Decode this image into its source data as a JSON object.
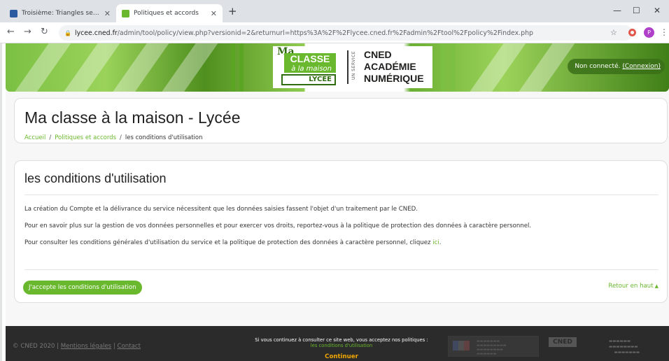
{
  "browser": {
    "tabs": [
      {
        "title": "Troisième: Triangles semblables",
        "active": false
      },
      {
        "title": "Politiques et accords",
        "active": true
      }
    ],
    "new_tab_icon": "plus-icon",
    "url_host": "lycee.cned.fr",
    "url_path": "/admin/tool/policy/view.php?versionid=2&returnurl=https%3A%2F%2Flycee.cned.fr%2Fadmin%2Ftool%2Fpolicy%2Findex.php",
    "avatar_letter": "P"
  },
  "banner": {
    "logo": {
      "ma": "Ma",
      "classe": "CLASSE",
      "a_la_maison": "à la maison",
      "lycee": "LYCÉE"
    },
    "service_label": "UN SERVICE",
    "cned_lines": [
      "CNED",
      "ACADÉMIE",
      "NUMÉRIQUE"
    ],
    "login_status": "Non connecté.",
    "login_link": "(Connexion)"
  },
  "header": {
    "site_title": "Ma classe à la maison - Lycée",
    "breadcrumb": {
      "home": "Accueil",
      "separator": "/",
      "policies": "Politiques et accords",
      "current": "les conditions d'utilisation"
    }
  },
  "policy": {
    "title": "les conditions d'utilisation",
    "paragraphs": [
      "La création du Compte et la délivrance du service nécessitent que les données saisies fassent l'objet d'un traitement par le CNED.",
      "Pour en savoir plus sur la gestion de vos données personnelles et pour exercer vos droits, reportez-vous à la politique de protection des données à caractère personnel.",
      "Pour consulter les conditions générales d'utilisation du service et la politique de protection des données à caractère personnel, cliquez "
    ],
    "link_here": "ici",
    "period": ".",
    "accept_button": "J'accepte les conditions d'utilisation",
    "back_to_top": "Retour en haut"
  },
  "footer": {
    "copyright": "© CNED 2020",
    "legal": "Mentions légales",
    "contact": "Contact",
    "divider": "|",
    "consent_text": "Si vous continuez à consulter ce site web, vous acceptez nos politiques :",
    "consent_link": "les conditions d'utilisation",
    "continue_button": "Continuer",
    "cned_mini": "CNED"
  },
  "colors": {
    "accent": "#6ab82e",
    "footer_bg": "#2b2b2b",
    "continue": "#f0a500"
  }
}
